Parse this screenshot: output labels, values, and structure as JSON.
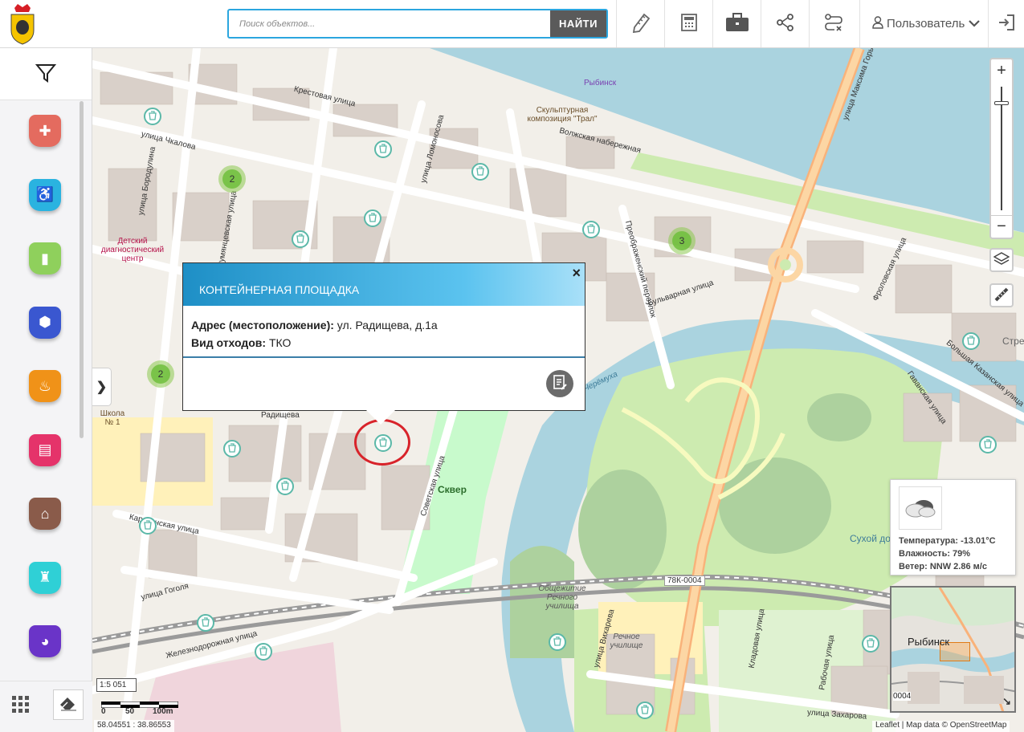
{
  "header": {
    "search": {
      "placeholder": "Поиск объектов...",
      "button_label": "НАЙТИ"
    },
    "user_label": "Пользователь",
    "tools": [
      "ruler-icon",
      "calculator-icon",
      "briefcase-icon",
      "share-icon",
      "route-icon"
    ]
  },
  "sidebar": {
    "categories": [
      {
        "name": "healthcare",
        "color": "#e46b5f"
      },
      {
        "name": "social",
        "color": "#2ab3e0"
      },
      {
        "name": "education",
        "color": "#8fd05c"
      },
      {
        "name": "culture",
        "color": "#3a57d0"
      },
      {
        "name": "sport",
        "color": "#f09218"
      },
      {
        "name": "commerce",
        "color": "#e5336a"
      },
      {
        "name": "architecture",
        "color": "#8a5b4a"
      },
      {
        "name": "tourism",
        "color": "#2fd0d6"
      },
      {
        "name": "other",
        "color": "#6a34c8"
      }
    ]
  },
  "map": {
    "street_labels": [
      "Крестовая улица",
      "Волжская набережная",
      "улица Чкалова",
      "улица Ломоносова",
      "Советская улица",
      "Карякинская улица",
      "улица Гоголя",
      "Железнодорожная улица",
      "Бульварная улица",
      "Преображенский переулок",
      "Фроловская улица",
      "Гаванская улица",
      "улица Максима Горького",
      "улица Захарова",
      "улица Вихарева",
      "Кладовая улица",
      "Рабочая улица",
      "Большая Казанская улица",
      "Румянцевская улица",
      "улица Бородулина",
      "Радищева",
      "Черёмуха"
    ],
    "poi_labels": [
      "Рыбинск",
      "Скульптурная композиция \"Трал\"",
      "Детский диагностический центр",
      "Школа № 1",
      "Сквер",
      "Общежитие Речного училища",
      "Речное училище",
      "Сухой до",
      "Стре",
      "78К-0004"
    ],
    "clusters": [
      "2",
      "3",
      "2"
    ]
  },
  "popup": {
    "title": "КОНТЕЙНЕРНАЯ ПЛОЩАДКА",
    "address_label": "Адрес (местоположение):",
    "address_value": "ул. Радищева, д.1а",
    "waste_label": "Вид отходов:",
    "waste_value": "ТКО",
    "close": "×"
  },
  "weather": {
    "temperature": "Температура: -13.01°C",
    "humidity": "Влажность: 79%",
    "wind": "Ветер: NNW 2.86 м/с"
  },
  "minimap": {
    "city": "Рыбинск",
    "road": "0004"
  },
  "scale": {
    "ratio": "1:5 051",
    "labels": [
      "0",
      "50",
      "100m"
    ]
  },
  "coords": "58.04551 : 38.86553",
  "attribution": "Leaflet | Map data © OpenStreetMap",
  "colors": {
    "accent": "#2ba6df",
    "bin_marker": "#5bb8a8",
    "cluster": "#7ec14a",
    "highlight": "#d8232a"
  }
}
